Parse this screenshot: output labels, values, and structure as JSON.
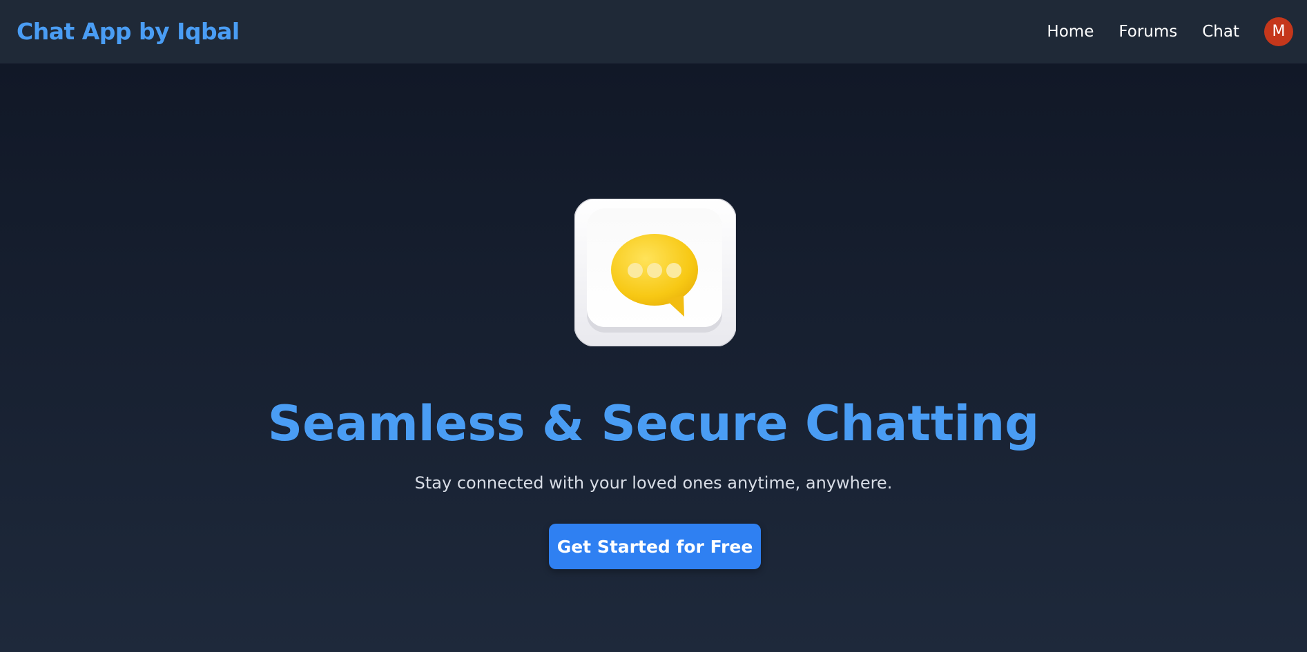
{
  "navbar": {
    "brand": "Chat App by Iqbal",
    "links": [
      {
        "label": "Home"
      },
      {
        "label": "Forums"
      },
      {
        "label": "Chat"
      }
    ],
    "avatar_initial": "M"
  },
  "hero": {
    "icon": "chat-bubble-icon",
    "title": "Seamless & Secure Chatting",
    "subtitle": "Stay connected with your loved ones anytime, anywhere.",
    "cta_label": "Get Started for Free"
  },
  "colors": {
    "accent": "#4a9df4",
    "button": "#2f80f2",
    "navbar_bg": "#1f2937",
    "page_bg": "#151b2b",
    "avatar_bg": "#c5371b",
    "bubble": "#f5c518"
  }
}
